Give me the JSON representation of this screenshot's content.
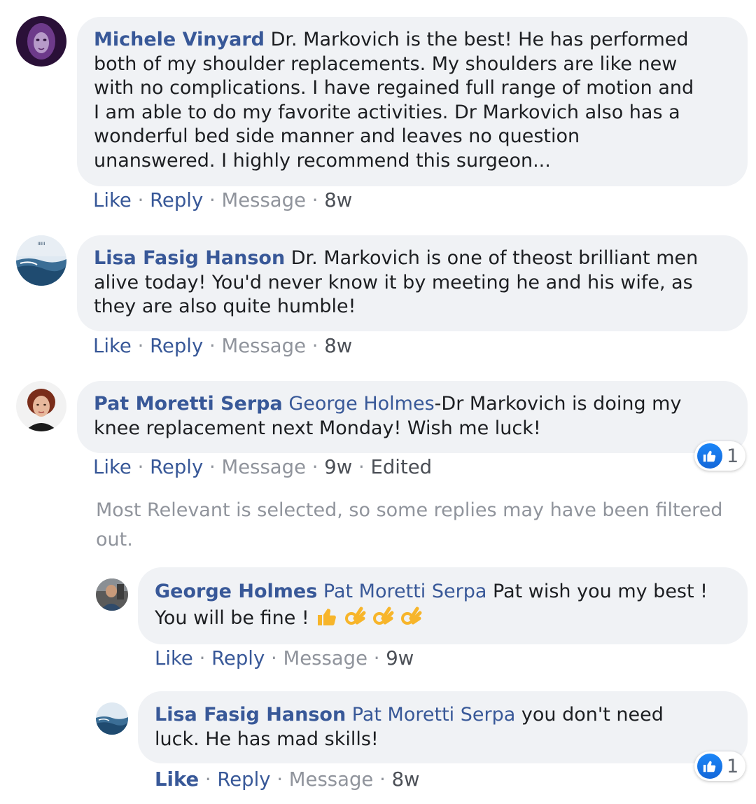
{
  "comments": [
    {
      "author": "Michele Vinyard",
      "lines": [
        "Dr. Markovich is the best! He has performed",
        "both of my shoulder replacements. My shoulders are like new",
        "with no complications. I have regained full range of motion and",
        "I am able to do my favorite activities. Dr Markovich also has a",
        "wonderful bed side manner and leaves no question",
        "unanswered. I highly recommend this surgeon..."
      ],
      "actions": {
        "like": "Like",
        "reply": "Reply",
        "message": "Message",
        "time": "8w"
      }
    },
    {
      "author": "Lisa Fasig Hanson",
      "lines": [
        "Dr. Markovich is one of theost brilliant men",
        "alive today! You'd never know it by meeting he and his wife, as",
        "they are also quite humble!"
      ],
      "actions": {
        "like": "Like",
        "reply": "Reply",
        "message": "Message",
        "time": "8w"
      }
    },
    {
      "author": "Pat Moretti Serpa",
      "tag": "George Holmes",
      "lines": [
        "-Dr Markovich is doing my",
        "knee replacement next Monday! Wish me luck!"
      ],
      "actions": {
        "like": "Like",
        "reply": "Reply",
        "message": "Message",
        "time": "9w",
        "edited": "Edited"
      },
      "reactions": {
        "count": "1",
        "icon": "like-icon",
        "color": "#1877f2"
      }
    }
  ],
  "notice": {
    "line1": "Most Relevant is selected, so some replies may have been filtered",
    "line2": "out."
  },
  "replies": [
    {
      "author": "George Holmes",
      "tag": "Pat Moretti Serpa",
      "line1": "Pat wish you my best !",
      "line2": "You will be fine !",
      "emojis": [
        "thumbs-up-emoji",
        "ok-hand-emoji",
        "ok-hand-emoji",
        "ok-hand-emoji"
      ],
      "actions": {
        "like": "Like",
        "reply": "Reply",
        "message": "Message",
        "time": "9w"
      }
    },
    {
      "author": "Lisa Fasig Hanson",
      "tag": "Pat Moretti Serpa",
      "line1": "you don't need",
      "line2": "luck. He has mad skills!",
      "actions": {
        "like": "Like",
        "reply": "Reply",
        "message": "Message",
        "time": "8w"
      },
      "reactions": {
        "count": "1",
        "icon": "like-icon",
        "color": "#1877f2"
      }
    }
  ],
  "colors": {
    "link": "#385898",
    "bubble": "#f0f2f5",
    "muted": "#90949c"
  }
}
